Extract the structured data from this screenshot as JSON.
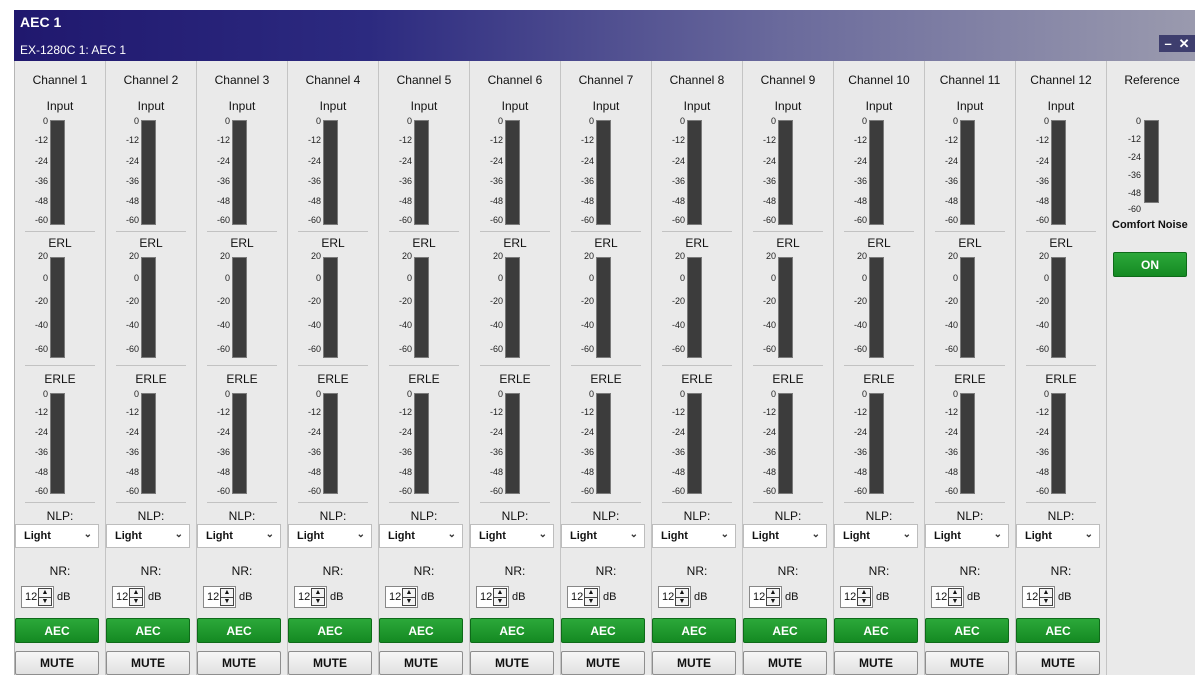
{
  "window": {
    "title": "AEC 1",
    "subtitle": "EX-1280C 1: AEC 1",
    "minimize_icon": "–",
    "close_icon": "✕"
  },
  "labels": {
    "input": "Input",
    "erl": "ERL",
    "erle": "ERLE",
    "nlp": "NLP:",
    "nr": "NR:",
    "db": "dB"
  },
  "ticks": {
    "input": [
      "0",
      "-12",
      "-24",
      "-36",
      "-48",
      "-60"
    ],
    "erl": [
      "20",
      "0",
      "-20",
      "-40",
      "-60"
    ],
    "erle": [
      "0",
      "-12",
      "-24",
      "-36",
      "-48",
      "-60"
    ]
  },
  "channels": [
    {
      "name": "Channel 1",
      "nlp": "Light",
      "nr": "12",
      "aec": "AEC",
      "mute": "MUTE"
    },
    {
      "name": "Channel 2",
      "nlp": "Light",
      "nr": "12",
      "aec": "AEC",
      "mute": "MUTE"
    },
    {
      "name": "Channel 3",
      "nlp": "Light",
      "nr": "12",
      "aec": "AEC",
      "mute": "MUTE"
    },
    {
      "name": "Channel 4",
      "nlp": "Light",
      "nr": "12",
      "aec": "AEC",
      "mute": "MUTE"
    },
    {
      "name": "Channel 5",
      "nlp": "Light",
      "nr": "12",
      "aec": "AEC",
      "mute": "MUTE"
    },
    {
      "name": "Channel 6",
      "nlp": "Light",
      "nr": "12",
      "aec": "AEC",
      "mute": "MUTE"
    },
    {
      "name": "Channel 7",
      "nlp": "Light",
      "nr": "12",
      "aec": "AEC",
      "mute": "MUTE"
    },
    {
      "name": "Channel 8",
      "nlp": "Light",
      "nr": "12",
      "aec": "AEC",
      "mute": "MUTE"
    },
    {
      "name": "Channel 9",
      "nlp": "Light",
      "nr": "12",
      "aec": "AEC",
      "mute": "MUTE"
    },
    {
      "name": "Channel 10",
      "nlp": "Light",
      "nr": "12",
      "aec": "AEC",
      "mute": "MUTE"
    },
    {
      "name": "Channel 11",
      "nlp": "Light",
      "nr": "12",
      "aec": "AEC",
      "mute": "MUTE"
    },
    {
      "name": "Channel 12",
      "nlp": "Light",
      "nr": "12",
      "aec": "AEC",
      "mute": "MUTE"
    }
  ],
  "reference": {
    "name": "Reference",
    "ticks": [
      "0",
      "-12",
      "-24",
      "-36",
      "-48",
      "-60"
    ],
    "comfort_noise_label": "Comfort Noise",
    "comfort_noise_button": "ON"
  },
  "colors": {
    "active_button": "#1e9a2e",
    "meter": "#3c3c3c",
    "title_bar": "#20186e"
  },
  "icons": {
    "nlp_dropdown": "chevron-down-icon",
    "nr_spinner": "spinner-arrows-icon"
  }
}
